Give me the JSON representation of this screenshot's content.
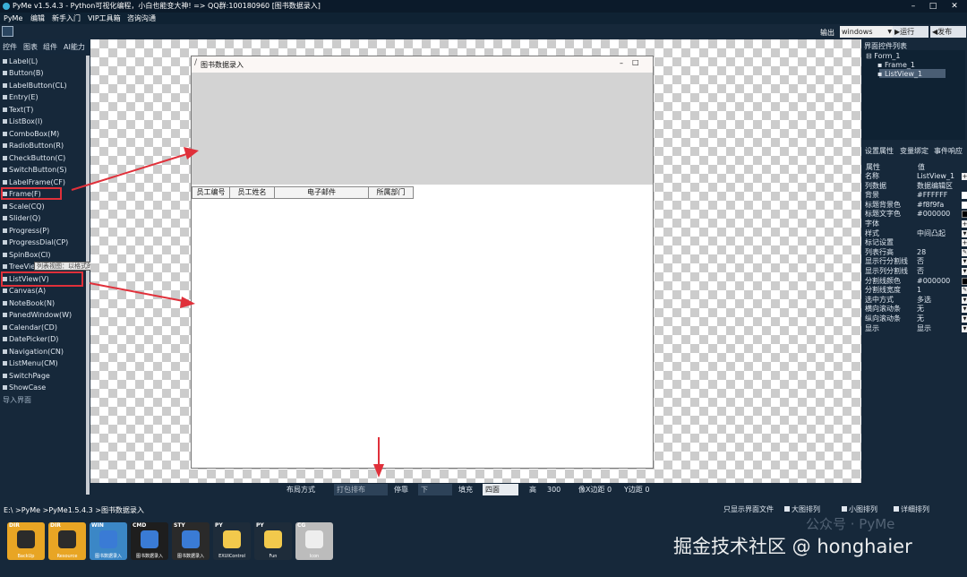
{
  "window": {
    "title": "PyMe v1.5.4.3 - Python可视化编程，小白也能变大神! => QQ群:100180960   [图书数据录入]"
  },
  "menu": [
    "PyMe",
    "编辑",
    "新手入门",
    "VIP工具箱",
    "咨询沟通"
  ],
  "toolbar": {
    "output_label": "输出",
    "output_value": "windows",
    "run_label": "▶运行",
    "publish_label": "◀发布"
  },
  "left_tabs": [
    "控件",
    "图表",
    "组件",
    "AI能力"
  ],
  "palette": [
    "Label(L)",
    "Button(B)",
    "LabelButton(CL)",
    "Entry(E)",
    "Text(T)",
    "ListBox(I)",
    "ComboBox(M)",
    "RadioButton(R)",
    "CheckButton(C)",
    "SwitchButton(S)",
    "LabelFrame(CF)",
    "Frame(F)",
    "Scale(CQ)",
    "Slider(Q)",
    "Progress(P)",
    "ProgressDial(CP)",
    "SpinBox(CI)",
    "TreeView",
    "ListView(V)",
    "Canvas(A)",
    "NoteBook(N)",
    "PanedWindow(W)",
    "Calendar(CD)",
    "DatePicker(D)",
    "Navigation(CN)",
    "ListMenu(CM)",
    "SwitchPage",
    "ShowCase",
    "导入界面"
  ],
  "tooltip": "列表视图：以格式的数据列表 (V)",
  "form": {
    "title": "图书数据录入",
    "min": "–",
    "max": "□",
    "columns": [
      "员工编号",
      "员工姓名",
      "电子邮件",
      "所属部门"
    ]
  },
  "layout_bar": {
    "layout_label": "布局方式",
    "layout_value": "打包排布",
    "dock_label": "停靠",
    "dock_value": "下",
    "fill_label": "填充",
    "fill_value": "四面",
    "height_label": "高",
    "height_value": "300",
    "padx": "像X边距 0",
    "pady": "Y边距 0"
  },
  "right_panel": {
    "header": "界面控件列表",
    "tree": [
      "Form_1",
      "Frame_1",
      "ListView_1"
    ],
    "prop_tabs": [
      "设置属性",
      "变量绑定",
      "事件响应"
    ],
    "prop_header": [
      "属性",
      "值"
    ],
    "props": [
      {
        "k": "名称",
        "v": "ListView_1",
        "ctl": "plus"
      },
      {
        "k": "列数据",
        "v": "数据编辑区",
        "ctl": "none"
      },
      {
        "k": "背景",
        "v": "#FFFFFF",
        "ctl": "white"
      },
      {
        "k": "标题背景色",
        "v": "#f8f9fa",
        "ctl": "white"
      },
      {
        "k": "标题文字色",
        "v": "#000000",
        "ctl": "black"
      },
      {
        "k": "字体",
        "v": "",
        "ctl": "plus"
      },
      {
        "k": "样式",
        "v": "中间凸起",
        "ctl": "down"
      },
      {
        "k": "标记设置",
        "v": "",
        "ctl": "plus"
      },
      {
        "k": "列表行高",
        "v": "28",
        "ctl": "edit"
      },
      {
        "k": "显示行分割线",
        "v": "否",
        "ctl": "down"
      },
      {
        "k": "显示列分割线",
        "v": "否",
        "ctl": "down"
      },
      {
        "k": "分割线颜色",
        "v": "#000000",
        "ctl": "black"
      },
      {
        "k": "分割线宽度",
        "v": "1",
        "ctl": "edit"
      },
      {
        "k": "选中方式",
        "v": "多选",
        "ctl": "down"
      },
      {
        "k": "横向滚动条",
        "v": "无",
        "ctl": "down"
      },
      {
        "k": "纵向滚动条",
        "v": "无",
        "ctl": "down"
      },
      {
        "k": "显示",
        "v": "显示",
        "ctl": "down"
      }
    ]
  },
  "status": {
    "path": "E:\\ >PyMe >PyMe1.5.4.3 >图书数据录入",
    "options": [
      "只显示界面文件",
      "大图排列",
      "小图排列",
      "详细排列"
    ]
  },
  "files": [
    {
      "tag": "DIR",
      "label": "BackUp",
      "color": "#e8a524"
    },
    {
      "tag": "DIR",
      "label": "Resource",
      "color": "#e8a524"
    },
    {
      "tag": "WIN",
      "label": "图书数据录入",
      "color": "#3b87c6"
    },
    {
      "tag": "CMD",
      "label": "图书数据录入",
      "color": "#1e1e1e"
    },
    {
      "tag": "STY",
      "label": "图书数据录入",
      "color": "#2a2a2a"
    },
    {
      "tag": "PY",
      "label": "EXUIControl",
      "color": "#1e2c3a"
    },
    {
      "tag": "PY",
      "label": "Fun",
      "color": "#1e2c3a"
    },
    {
      "tag": "CG",
      "label": "Icon",
      "color": "#bcbcbc"
    }
  ],
  "watermark": "掘金技术社区 @ honghaier",
  "watermark_logo": "公众号 · PyMe",
  "colors": {
    "highlight": "#e0303a",
    "arrow": "#e0303a"
  }
}
